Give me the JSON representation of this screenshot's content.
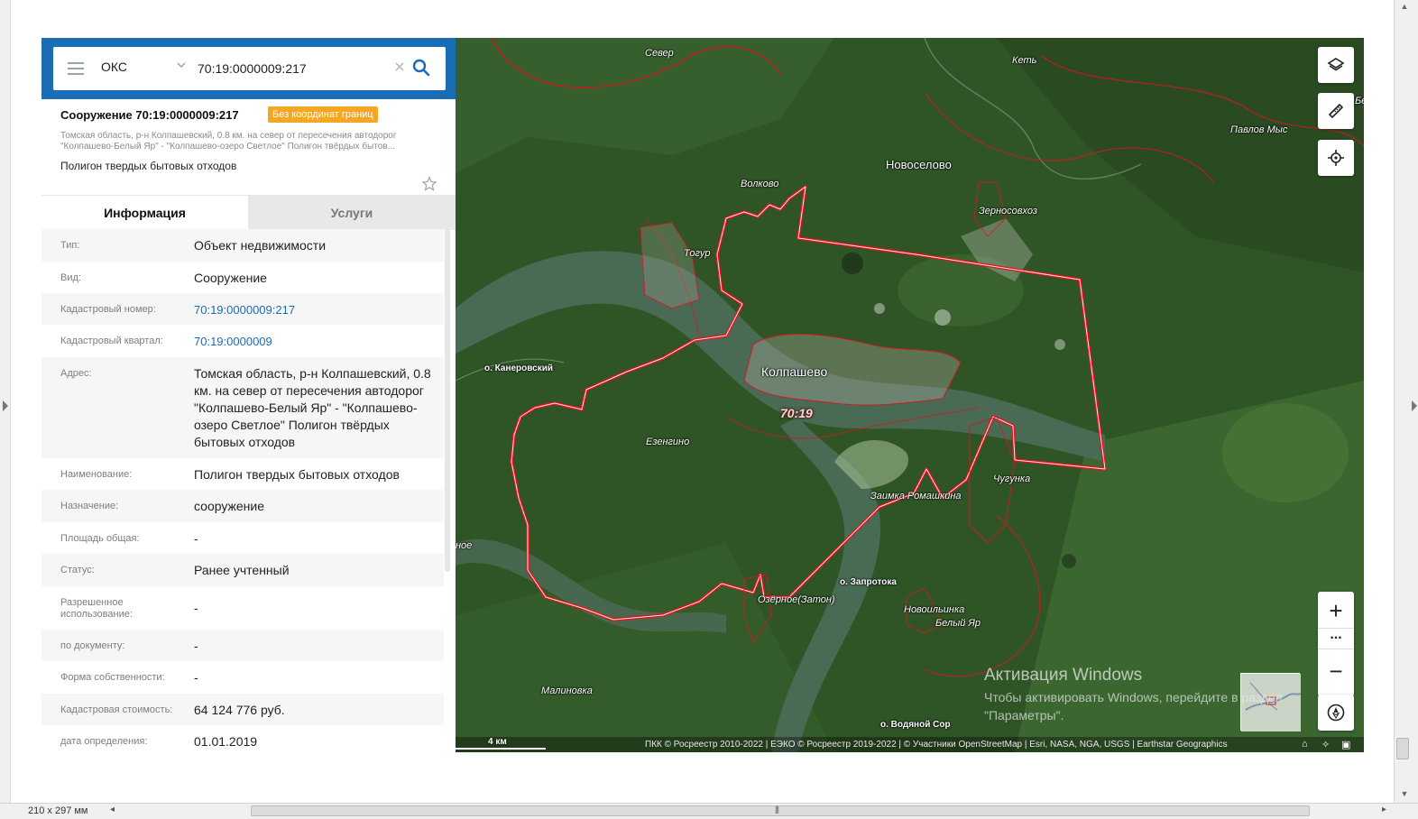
{
  "search": {
    "type_value": "ОКС",
    "query_value": "70:19:0000009:217"
  },
  "object": {
    "title": "Сооружение 70:19:0000009:217",
    "badge": "Без координат границ",
    "address_short_line1": "Томская область, р-н Колпашевский, 0.8 км. на север от пересечения автодорог",
    "address_short_line2": "\"Колпашево-Белый Яр\" - \"Колпашево-озеро Светлое\" Полигон твёрдых бытов...",
    "name": "Полигон твердых бытовых отходов"
  },
  "tabs": [
    {
      "label": "Информация"
    },
    {
      "label": "Услуги"
    }
  ],
  "info_rows": [
    {
      "label": "Тип:",
      "value": "Объект недвижимости"
    },
    {
      "label": "Вид:",
      "value": "Сооружение"
    },
    {
      "label": "Кадастровый номер:",
      "value": "70:19:0000009:217"
    },
    {
      "label": "Кадастровый квартал:",
      "value": "70:19:0000009"
    },
    {
      "label": "Адрес:",
      "value": "Томская область, р-н Колпашевский, 0.8 км. на север от пересечения автодорог \"Колпашево-Белый Яр\" - \"Колпашево-озеро Светлое\" Полигон твёрдых бытовых отходов"
    },
    {
      "label": "Наименование:",
      "value": "Полигон твердых бытовых отходов"
    },
    {
      "label": "Назначение:",
      "value": "сооружение"
    },
    {
      "label": "Площадь общая:",
      "value": "-"
    },
    {
      "label": "Статус:",
      "value": "Ранее учтенный"
    },
    {
      "label": "Разрешенное использование:",
      "value": "-"
    },
    {
      "label": "по документу:",
      "value": "-"
    },
    {
      "label": "Форма собственности:",
      "value": "-"
    },
    {
      "label": "Кадастровая стоимость:",
      "value": "64 124 776 руб."
    },
    {
      "label": "дата определения:",
      "value": "01.01.2019"
    }
  ],
  "map": {
    "labels": {
      "sever": "Север",
      "ket": "Кеть",
      "pavlov_mys": "Павлов Мыс",
      "novoselovo": "Новоселово",
      "volkovo": "Волково",
      "zernosovhoz": "Зерносовхоз",
      "togur": "Тогур",
      "kanerovsky": "о. Канеровский",
      "kolpashevo": "Колпашево",
      "quarter": "70:19",
      "ezengino": "Езенгино",
      "chugunka": "Чугунка",
      "zaimka": "Заимка Ромашкина",
      "ozernoe": "Озёрное(Затон)",
      "zaprotoka": "о. Запротока",
      "novoilinka": "Новоильинка",
      "bely_yar": "Белый Яр",
      "malinovka": "Малиновка",
      "vodyanoy": "о. Водяной Сор",
      "edge_left": "ное",
      "edge_right": "Бе"
    },
    "scale": "4 км",
    "attribution": "ПКК © Росреестр 2010-2022 | ЕЭКО © Росреестр 2019-2022 | © Участники OpenStreetMap | Esri, NASA, NGA, USGS | Earthstar Geographics",
    "watermark_title": "Активация Windows",
    "watermark_sub": "Чтобы активировать Windows, перейдите в раздел \"Параметры\"."
  },
  "status": {
    "paper_size": "210 x 297 мм"
  },
  "colors": {
    "accent": "#1a6cb4",
    "badge": "#f5a623",
    "boundary": "#e3121b"
  }
}
